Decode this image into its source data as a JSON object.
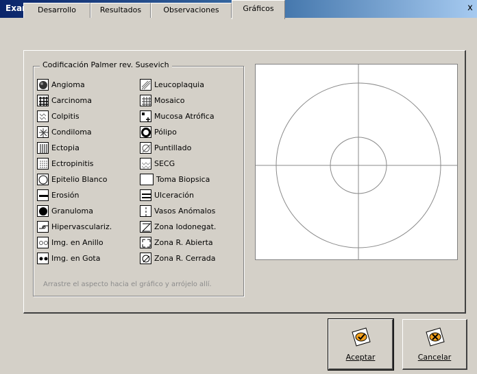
{
  "window": {
    "title": "Examen colposcopico",
    "close_label": "x"
  },
  "tabs": [
    {
      "label": "Desarrollo",
      "active": false
    },
    {
      "label": "Resultados",
      "active": false
    },
    {
      "label": "Observaciones",
      "active": false
    },
    {
      "label": "Gráficos",
      "active": true
    }
  ],
  "legend": {
    "title": "Codificación Palmer rev. Susevich",
    "left_items": [
      {
        "label": "Angioma",
        "icon": "angioma-icon"
      },
      {
        "label": "Carcinoma",
        "icon": "carcinoma-icon"
      },
      {
        "label": "Colpitis",
        "icon": "colpitis-icon"
      },
      {
        "label": "Condiloma",
        "icon": "condiloma-icon"
      },
      {
        "label": "Ectopia",
        "icon": "ectopia-icon"
      },
      {
        "label": "Ectropinitis",
        "icon": "ectropinitis-icon"
      },
      {
        "label": "Epitelio Blanco",
        "icon": "epitelio-blanco-icon"
      },
      {
        "label": "Erosión",
        "icon": "erosion-icon"
      },
      {
        "label": "Granuloma",
        "icon": "granuloma-icon"
      },
      {
        "label": "Hipervasculariz.",
        "icon": "hipervascularizacion-icon"
      },
      {
        "label": "Img. en Anillo",
        "icon": "img-anillo-icon"
      },
      {
        "label": "Img. en Gota",
        "icon": "img-gota-icon"
      }
    ],
    "right_items": [
      {
        "label": "Leucoplaquia",
        "icon": "leucoplaquia-icon"
      },
      {
        "label": "Mosaico",
        "icon": "mosaico-icon"
      },
      {
        "label": "Mucosa Atrófica",
        "icon": "mucosa-atrofica-icon"
      },
      {
        "label": "Pólipo",
        "icon": "polipo-icon"
      },
      {
        "label": "Puntillado",
        "icon": "puntillado-icon"
      },
      {
        "label": "SECG",
        "icon": "secg-icon"
      },
      {
        "label": "Toma Biopsica",
        "icon": "toma-biopsica-icon"
      },
      {
        "label": "Ulceración",
        "icon": "ulceracion-icon"
      },
      {
        "label": "Vasos Anómalos",
        "icon": "vasos-anomalos-icon"
      },
      {
        "label": "Zona Iodonegat.",
        "icon": "zona-iodonegativa-icon"
      },
      {
        "label": "Zona R. Abierta",
        "icon": "zona-r-abierta-icon"
      },
      {
        "label": "Zona R. Cerrada",
        "icon": "zona-r-cerrada-icon"
      }
    ],
    "hint": "Arrastre el aspecto hacia el gráfico y arrójelo allí."
  },
  "buttons": {
    "accept_label": "Aceptar",
    "cancel_label": "Cancelar"
  },
  "colors": {
    "title_bar": "#0a246a",
    "face": "#d4d0c8",
    "accept_icon": "#f0a020"
  }
}
